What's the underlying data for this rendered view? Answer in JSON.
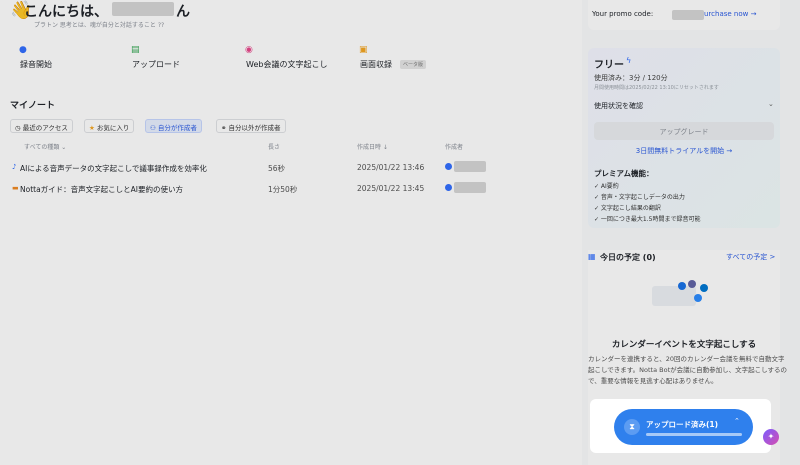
{
  "greeting": {
    "title": "こんにちは、",
    "suffix": "ん",
    "subtitle": "プラトン 思考とは、魂が自分と対話すること ??",
    "wave_icon": "waving-hand-icon"
  },
  "actions": [
    {
      "label": "録音開始",
      "icon": "microphone-icon"
    },
    {
      "label": "アップロード",
      "icon": "upload-file-icon"
    },
    {
      "label": "Web会議の文字起こし",
      "icon": "web-meeting-icon"
    },
    {
      "label": "画面収録",
      "icon": "screen-record-icon",
      "badge": "ベータ版"
    }
  ],
  "notes": {
    "title": "マイノート",
    "filters": [
      "最近のアクセス",
      "お気に入り",
      "自分が作成者",
      "自分以外が作成者"
    ],
    "active_filter": "自分が作成者",
    "columns": [
      "すべての種類 ⌄",
      "長さ",
      "作成日時 ↓",
      "作成者"
    ],
    "rows": [
      {
        "name": "AIによる音声データの文字起こしで議事録作成を効率化",
        "length": "56秒",
        "date": "2025/01/22 13:46"
      },
      {
        "name": "Nottaガイド：音声文字起こしとAI要約の使い方",
        "length": "1分50秒",
        "date": "2025/01/22 13:45"
      }
    ]
  },
  "sidebar": {
    "promo_label": "Your promo code:",
    "promo_link": "urchase now →",
    "plan": {
      "name": "フリー",
      "usage": "使用済み：3分 / 120分",
      "reset": "月間使用時間は2025/02/22 13:10にリセットされます",
      "check_usage": "使用状況を確認",
      "upgrade": "アップグレード",
      "trial": "3日間無料トライアルを開始 →",
      "features_title": "プレミアム機能：",
      "features": [
        "✓ AI要約",
        "✓ 音声・文字起こしデータの出力",
        "✓ 文字起こし結果の翻訳",
        "✓ 一回につき最大1.5時間まで録音可能"
      ]
    },
    "today": {
      "title": "今日の予定 (0)",
      "all_link": "すべての予定 >",
      "cal_title": "カレンダーイベントを文字起こしする",
      "cal_desc": "カレンダーを連携すると、20回のカレンダー会議を無料で自動文字起こしできます。Notta Botが会議に自動参加し、文字起こしするので、重要な情報を見逃す心配はありません。"
    }
  },
  "upload": {
    "label": "アップロード済み(1)",
    "progress": 1.0
  },
  "colors": {
    "accent": "#2f80ed",
    "link": "#2b5ce6"
  }
}
